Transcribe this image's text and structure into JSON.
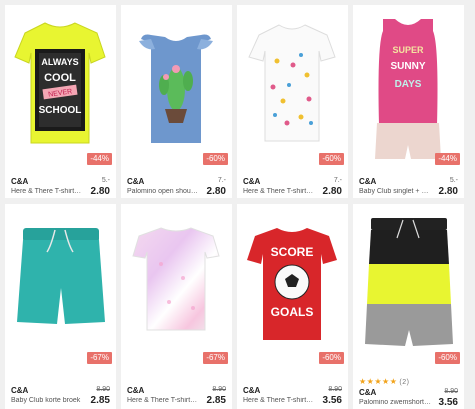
{
  "products": [
    {
      "brand": "C&A",
      "name": "Here & There T-shirt met tekstopdruk",
      "old_price": "5.-",
      "price": "2.80",
      "discount": "-44%"
    },
    {
      "brand": "C&A",
      "name": "Palomino open shoulder T-shirt",
      "old_price": "7.-",
      "price": "2.80",
      "discount": "-60%"
    },
    {
      "brand": "C&A",
      "name": "Here & There T-shirt met all-over print",
      "old_price": "7.-",
      "price": "2.80",
      "discount": "-60%"
    },
    {
      "brand": "C&A",
      "name": "Baby Club singlet + short",
      "old_price": "5.-",
      "price": "2.80",
      "discount": "-44%"
    },
    {
      "brand": "C&A",
      "name": "Baby Club korte broek",
      "old_price": "8.90",
      "price": "2.85",
      "discount": "-67%"
    },
    {
      "brand": "C&A",
      "name": "Here & There T-shirt met pailletten",
      "old_price": "8.90",
      "price": "2.85",
      "discount": "-67%"
    },
    {
      "brand": "C&A",
      "name": "Here & There T-shirt met print",
      "old_price": "8.90",
      "price": "3.56",
      "discount": "-60%"
    },
    {
      "brand": "C&A",
      "name": "Palomino zwemshort zwart",
      "old_price": "8.90",
      "price": "3.56",
      "discount": "-60%",
      "rating_count": "(2)",
      "stars": "★★★★★"
    }
  ],
  "graphics": {
    "shirt1_text": [
      "ALWAYS",
      "COOL",
      "NEVER",
      "SCHOOL"
    ],
    "shirt4_text": [
      "SUPER",
      "SUNNY",
      "DAYS"
    ],
    "shirt7_text": [
      "SCORE",
      "GOALS"
    ]
  },
  "colors": {
    "discount_badge": "#e8716a",
    "neon_yellow": "#e8f531",
    "blue_top": "#6e97cd",
    "pink_top": "#e04a86",
    "teal_short": "#2fb3ac",
    "red_shirt": "#d8262a",
    "rating_star": "#f2a31a"
  }
}
